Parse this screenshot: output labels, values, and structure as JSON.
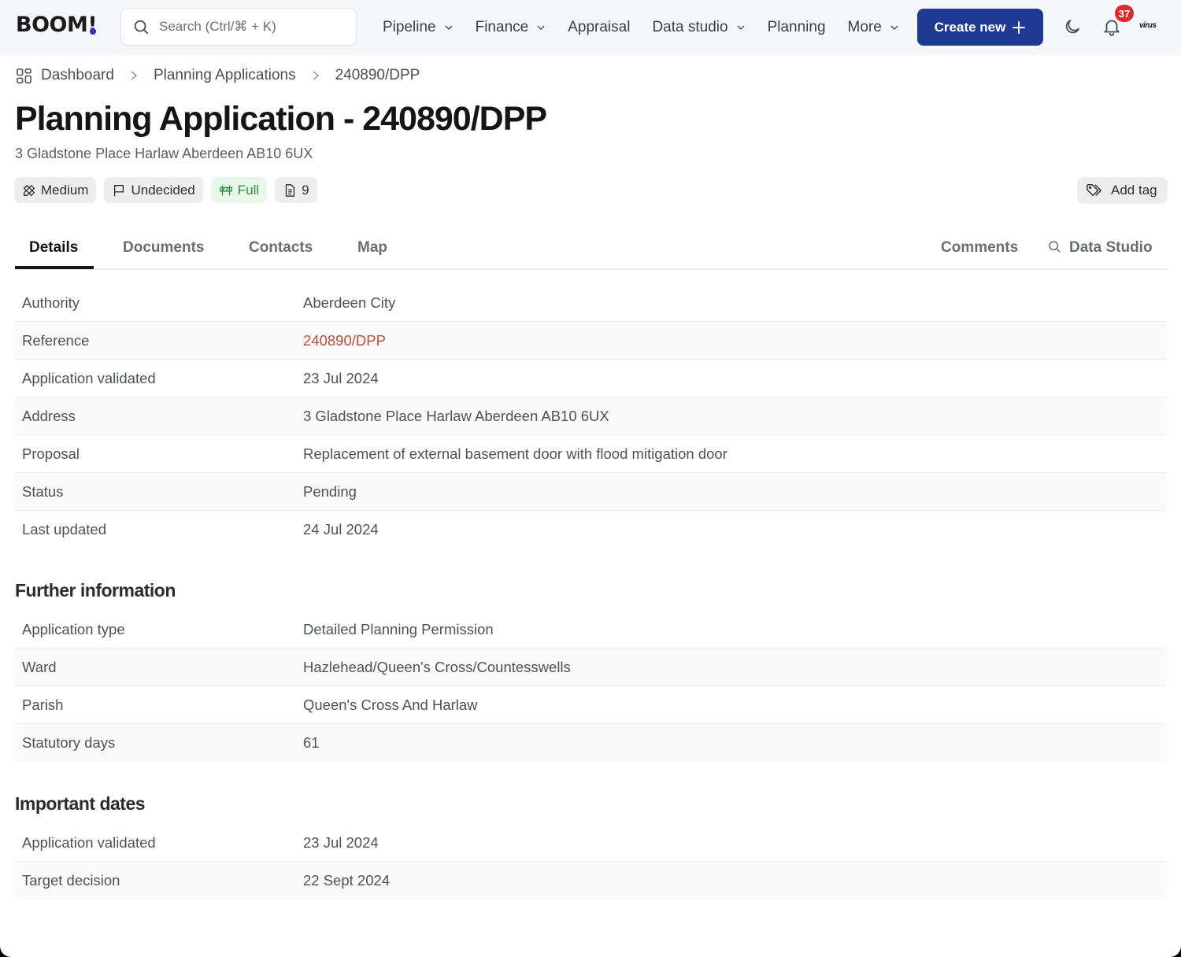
{
  "header": {
    "logo": "BOOM!",
    "search_placeholder": "Search (Ctrl/⌘ + K)",
    "nav": [
      {
        "label": "Pipeline",
        "dropdown": true
      },
      {
        "label": "Finance",
        "dropdown": true
      },
      {
        "label": "Appraisal",
        "dropdown": false
      },
      {
        "label": "Data studio",
        "dropdown": true
      },
      {
        "label": "Planning",
        "dropdown": false
      },
      {
        "label": "More",
        "dropdown": true
      }
    ],
    "create_label": "Create new",
    "notification_count": "37",
    "user_org": "virus",
    "accent_color": "#1f3a93",
    "badge_color": "#d92d2d"
  },
  "breadcrumb": [
    "Dashboard",
    "Planning Applications",
    "240890/DPP"
  ],
  "page": {
    "title": "Planning Application - 240890/DPP",
    "subtitle": "3 Gladstone Place Harlaw Aberdeen AB10 6UX"
  },
  "tags": [
    {
      "icon": "ruler-pencil-icon",
      "label": "Medium"
    },
    {
      "icon": "flag-icon",
      "label": "Undecided"
    },
    {
      "icon": "barrier-icon",
      "label": "Full",
      "color": "#2f8f3a"
    },
    {
      "icon": "document-icon",
      "label": "9"
    }
  ],
  "add_tag_label": "Add tag",
  "tabs": [
    {
      "label": "Details",
      "active": true
    },
    {
      "label": "Documents"
    },
    {
      "label": "Contacts"
    },
    {
      "label": "Map"
    },
    {
      "label": "Comments"
    },
    {
      "label": "Data Studio"
    }
  ],
  "details": [
    {
      "key": "Authority",
      "value": "Aberdeen City"
    },
    {
      "key": "Reference",
      "value": "240890/DPP",
      "link": true
    },
    {
      "key": "Application validated",
      "value": "23 Jul 2024"
    },
    {
      "key": "Address",
      "value": "3 Gladstone Place Harlaw Aberdeen AB10 6UX"
    },
    {
      "key": "Proposal",
      "value": "Replacement of external basement door with flood mitigation door"
    },
    {
      "key": "Status",
      "value": "Pending"
    },
    {
      "key": "Last updated",
      "value": "24 Jul 2024"
    }
  ],
  "further_information": {
    "heading": "Further information",
    "rows": [
      {
        "key": "Application type",
        "value": "Detailed Planning Permission"
      },
      {
        "key": "Ward",
        "value": "Hazlehead/Queen's Cross/Countesswells"
      },
      {
        "key": "Parish",
        "value": "Queen's Cross And Harlaw"
      },
      {
        "key": "Statutory days",
        "value": "61"
      }
    ]
  },
  "important_dates": {
    "heading": "Important dates",
    "rows": [
      {
        "key": "Application validated",
        "value": "23 Jul 2024"
      },
      {
        "key": "Target decision",
        "value": "22 Sept 2024"
      }
    ]
  },
  "link_color": "#b5513a"
}
